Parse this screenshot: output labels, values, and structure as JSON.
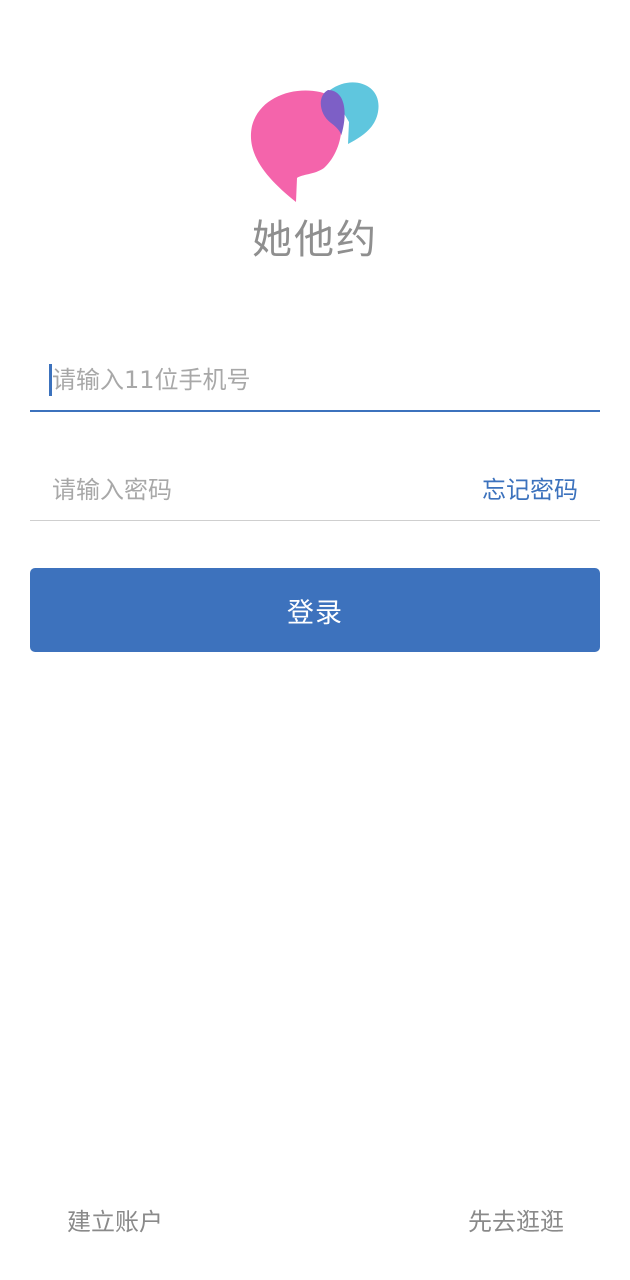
{
  "app": {
    "name": "她他约"
  },
  "login_form": {
    "phone_placeholder": "请输入11位手机号",
    "phone_value": "",
    "password_placeholder": "请输入密码",
    "password_value": "",
    "forgot_password_label": "忘记密码",
    "login_label": "登录"
  },
  "footer": {
    "create_account_label": "建立账户",
    "browse_label": "先去逛逛"
  },
  "colors": {
    "accent": "#3D72BD",
    "logo_pink": "#F464AB",
    "logo_cyan": "#5FC6DE",
    "logo_overlap": "#7D5FC6"
  },
  "icons": {
    "logo": "speech-bubbles-logo"
  }
}
